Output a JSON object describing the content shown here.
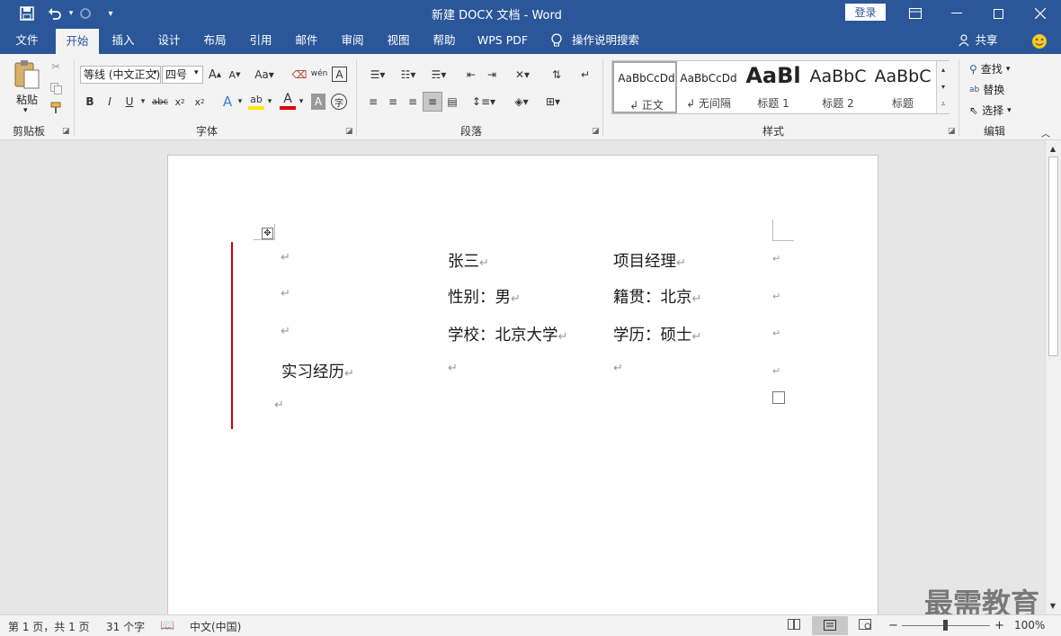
{
  "title_bar": {
    "document_title": "新建 DOCX 文档 - Word",
    "login_label": "登录",
    "quick_access": [
      "save-icon",
      "undo-icon",
      "redo-icon",
      "customize-icon"
    ]
  },
  "tabs": [
    {
      "label": "文件"
    },
    {
      "label": "开始"
    },
    {
      "label": "插入"
    },
    {
      "label": "设计"
    },
    {
      "label": "布局"
    },
    {
      "label": "引用"
    },
    {
      "label": "邮件"
    },
    {
      "label": "审阅"
    },
    {
      "label": "视图"
    },
    {
      "label": "帮助"
    },
    {
      "label": "WPS PDF"
    },
    {
      "label": "操作说明搜索"
    }
  ],
  "share_label": "共享",
  "ribbon": {
    "clipboard": {
      "paste_label": "粘贴",
      "group_label": "剪贴板"
    },
    "font": {
      "font_name": "等线 (中文正文)",
      "font_size": "四号",
      "group_label": "字体"
    },
    "paragraph": {
      "group_label": "段落"
    },
    "styles": {
      "group_label": "样式",
      "items": [
        {
          "preview": "AaBbCcDd",
          "name": "↲ 正文"
        },
        {
          "preview": "AaBbCcDd",
          "name": "↲ 无间隔"
        },
        {
          "preview": "AaBl",
          "name": "标题 1"
        },
        {
          "preview": "AaBbC",
          "name": "标题 2"
        },
        {
          "preview": "AaBbC",
          "name": "标题"
        }
      ]
    },
    "editing": {
      "find": "查找",
      "replace": "替换",
      "select": "选择",
      "group_label": "编辑"
    }
  },
  "document": {
    "row1": {
      "c2": "张三",
      "c3": "项目经理"
    },
    "row2": {
      "c2": "性别：男",
      "c3": "籍贯：北京"
    },
    "row3": {
      "c2": "学校：北京大学",
      "c3": "学历：硕士"
    },
    "row4": {
      "c1": "实习经历"
    },
    "paragraph_mark": "↵"
  },
  "status": {
    "page": "第 1 页，共 1 页",
    "words": "31 个字",
    "language": "中文(中国)",
    "zoom": "100%",
    "zoom_value": 100
  },
  "watermark": "最需教育",
  "colors": {
    "brand": "#2b579a",
    "revision_bar": "#d00000"
  }
}
